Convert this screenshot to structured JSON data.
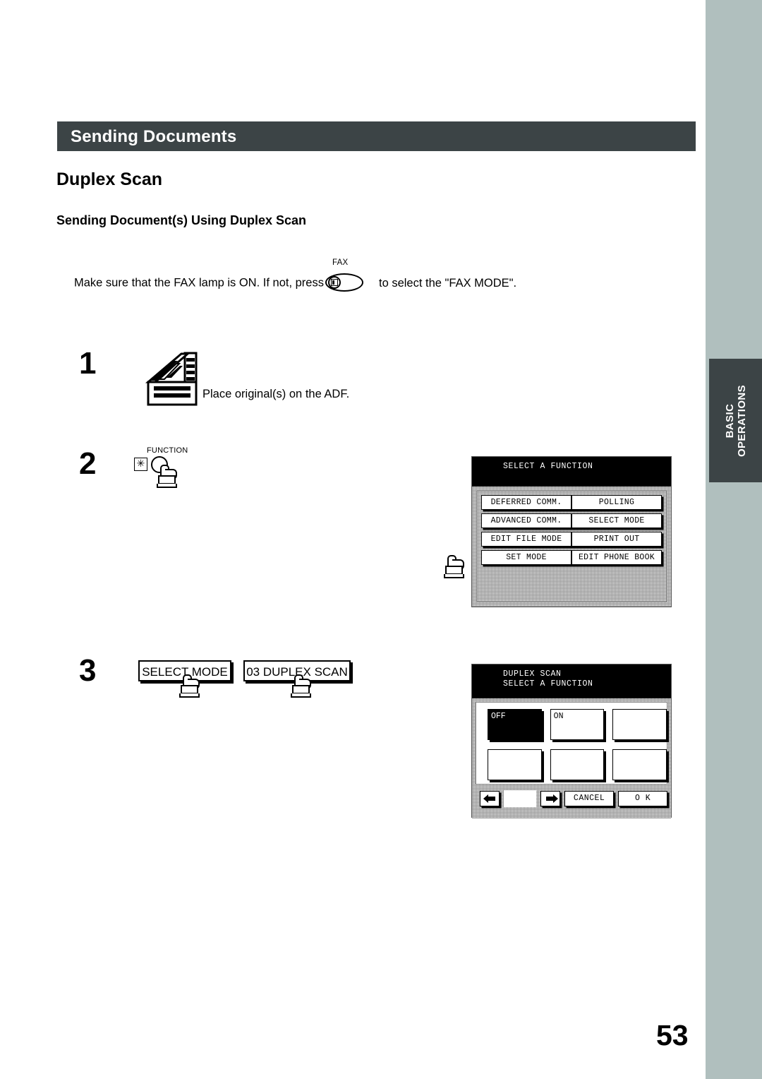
{
  "header": {
    "title": "Sending Documents"
  },
  "headings": {
    "h1": "Duplex Scan",
    "h2": "Sending Document(s) Using Duplex Scan"
  },
  "intro": {
    "before": "Make sure that the FAX lamp is ON.  If not, press",
    "fax_key_label": "FAX",
    "after": "to select the \"FAX MODE\"."
  },
  "side_tab": {
    "line1": "BASIC",
    "line2": "OPERATIONS"
  },
  "steps": [
    {
      "number": "1",
      "icon": "documents-stack-icon",
      "text": "Place original(s) on the ADF."
    },
    {
      "number": "2",
      "key_label": "FUNCTION",
      "asterisk": "✳"
    },
    {
      "number": "3",
      "key1": "SELECT MODE",
      "key2": "03 DUPLEX SCAN"
    }
  ],
  "lcd_function": {
    "title": "SELECT A FUNCTION",
    "rows": [
      [
        "DEFERRED COMM.",
        "POLLING"
      ],
      [
        "ADVANCED COMM.",
        "SELECT MODE"
      ],
      [
        "EDIT FILE MODE",
        "PRINT OUT"
      ],
      [
        "SET MODE",
        "EDIT PHONE BOOK"
      ]
    ]
  },
  "lcd_duplex": {
    "title_line1": "DUPLEX SCAN",
    "title_line2": "SELECT A FUNCTION",
    "cells_row1": [
      "OFF",
      "ON",
      ""
    ],
    "cells_row2": [
      "",
      "",
      ""
    ],
    "selected_cell": "OFF",
    "nav": {
      "prev": "←",
      "next": "→"
    },
    "cancel": "CANCEL",
    "ok": "O K"
  },
  "page_number": "53",
  "colors": {
    "header_bar": "#3c4446",
    "edge_strip": "#b0bfbe",
    "tab": "#3c4446"
  }
}
